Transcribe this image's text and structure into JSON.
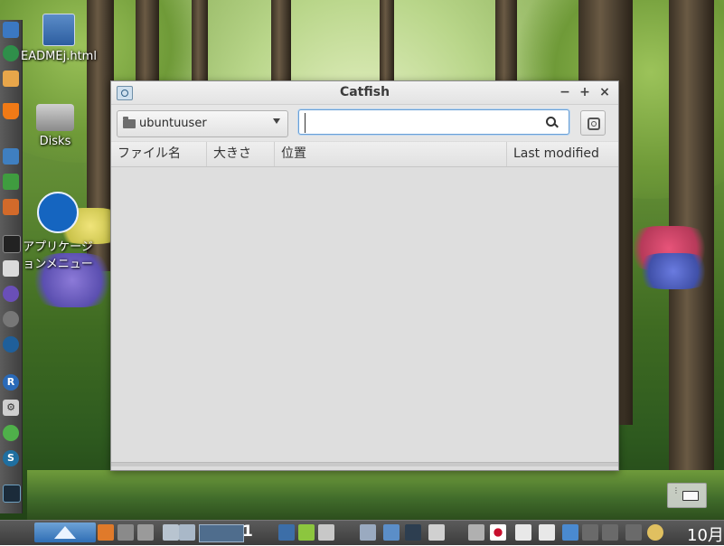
{
  "desktop": {
    "icons": [
      {
        "name": "readme-file",
        "label": "EADMEj.html"
      },
      {
        "name": "disks",
        "label": "Disks"
      },
      {
        "name": "app-menu",
        "label_line1": "アプリケージ",
        "label_line2": "ョンメニュー"
      }
    ]
  },
  "window": {
    "title": "Catfish",
    "controls": {
      "minimize": "−",
      "maximize": "+",
      "close": "×"
    },
    "toolbar": {
      "folder": "ubuntuuser",
      "search_value": "",
      "search_placeholder": ""
    },
    "columns": [
      "ファイル名",
      "大きさ",
      "位置",
      "Last modified"
    ]
  },
  "panel": {
    "workspace_number": "1",
    "clock": "10月"
  },
  "colors": {
    "window_bg": "#dcdcdc",
    "search_focus": "#6aa0d6",
    "panel_bg": "#3c3c3c",
    "start_blue": "#2f6eb5"
  }
}
